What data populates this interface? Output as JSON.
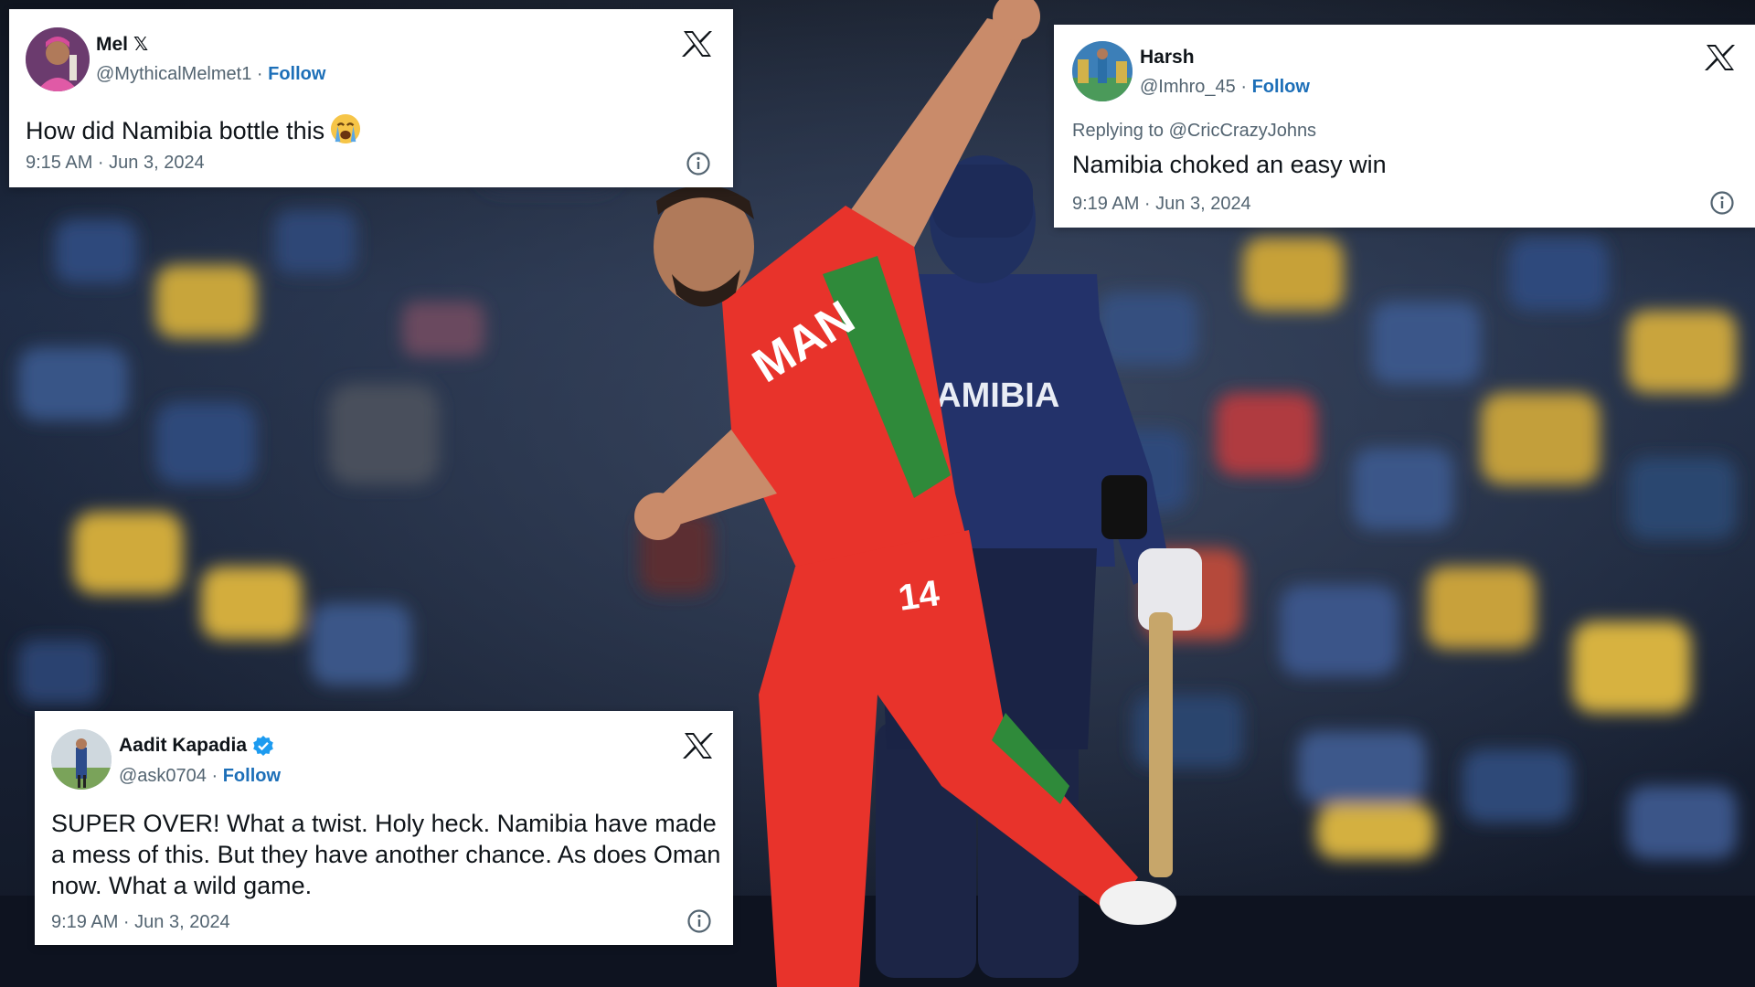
{
  "background": {
    "jersey_oman_text": "MAN",
    "jersey_namibia_text": "NAMIBIA",
    "jersey_number": "14"
  },
  "tweets": [
    {
      "name": "Mel",
      "name_badge": "𝕏",
      "handle": "@MythicalMelmet1",
      "follow": "Follow",
      "body": "How did Namibia bottle this",
      "emoji": "loudly-crying-face-emoji",
      "time": "9:15 AM · Jun 3, 2024",
      "logo": "x-logo-icon",
      "info": "info-icon"
    },
    {
      "name": "Harsh",
      "handle": "@Imhro_45",
      "follow": "Follow",
      "reply_to": "Replying to @CricCrazyJohns",
      "body": "Namibia choked an easy win",
      "time": "9:19 AM · Jun 3, 2024",
      "logo": "x-logo-icon",
      "info": "info-icon"
    },
    {
      "name": "Aadit Kapadia",
      "verified": "verified-badge-icon",
      "handle": "@ask0704",
      "follow": "Follow",
      "body": "SUPER OVER! What a twist. Holy heck. Namibia have made a mess of this. But they have another chance. As does Oman now. What a wild game.",
      "time": "9:19 AM · Jun 3, 2024",
      "logo": "x-logo-icon",
      "info": "info-icon"
    }
  ],
  "colors": {
    "follow": "#1d6fb8",
    "oman_red": "#e8332b",
    "oman_green": "#2f8a3a",
    "namibia_navy": "#1d2a55",
    "verified": "#1d9bf0"
  }
}
